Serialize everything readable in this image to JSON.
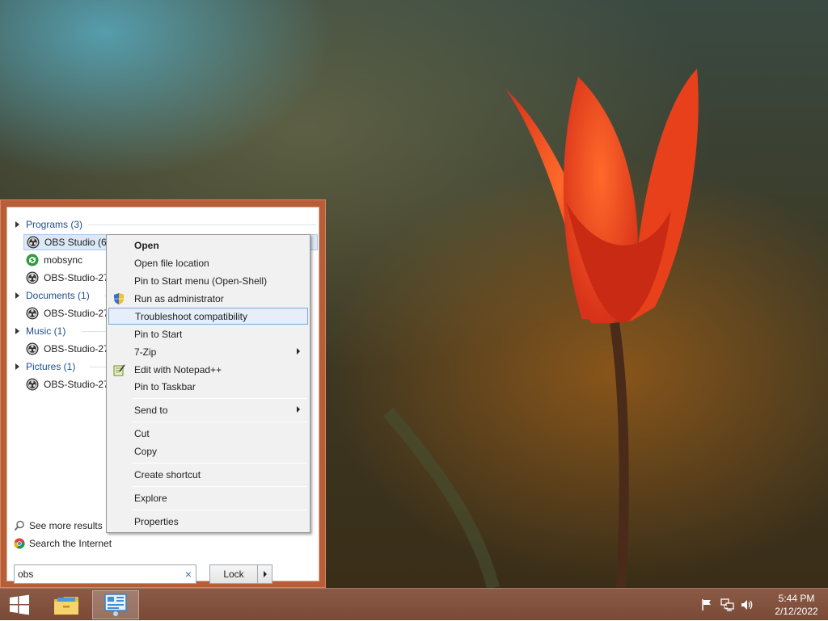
{
  "start_menu": {
    "groups": [
      {
        "label": "Programs (3)",
        "items": [
          "OBS Studio (64bit)",
          "mobsync",
          "OBS-Studio-27."
        ]
      },
      {
        "label": "Documents (1)",
        "items": [
          "OBS-Studio-27."
        ]
      },
      {
        "label": "Music (1)",
        "items": [
          "OBS-Studio-27."
        ]
      },
      {
        "label": "Pictures (1)",
        "items": [
          "OBS-Studio-27."
        ]
      }
    ],
    "see_more": "See more results",
    "search_internet": "Search the Internet",
    "search_value": "obs",
    "clear_glyph": "×",
    "lock_label": "Lock"
  },
  "context_menu": {
    "items": [
      {
        "label": "Open",
        "bold": true
      },
      {
        "label": "Open file location"
      },
      {
        "label": "Pin to Start menu (Open-Shell)"
      },
      {
        "label": "Run as administrator",
        "icon": "shield-icon"
      },
      {
        "label": "Troubleshoot compatibility",
        "highlighted": true
      },
      {
        "label": "Pin to Start"
      },
      {
        "label": "7-Zip",
        "submenu": true
      },
      {
        "label": "Edit with Notepad++",
        "icon": "notepad-icon"
      },
      {
        "label": "Pin to Taskbar"
      },
      {
        "label": "Send to",
        "submenu": true
      },
      {
        "label": "Cut"
      },
      {
        "label": "Copy"
      },
      {
        "label": "Create shortcut"
      },
      {
        "label": "Explore"
      },
      {
        "label": "Properties"
      }
    ]
  },
  "taskbar": {
    "time": "5:44 PM",
    "date": "2/12/2022",
    "pinned": [
      "start-icon",
      "file-explorer-icon",
      "control-panel-icon"
    ],
    "tray_icons": [
      "flag-icon",
      "network-icon",
      "speaker-icon"
    ]
  },
  "colors": {
    "start_menu_frame": "#b65e37",
    "taskbar": "#7a4a36",
    "link_blue": "#1e4e8c",
    "selection": "#dbe9f7"
  }
}
